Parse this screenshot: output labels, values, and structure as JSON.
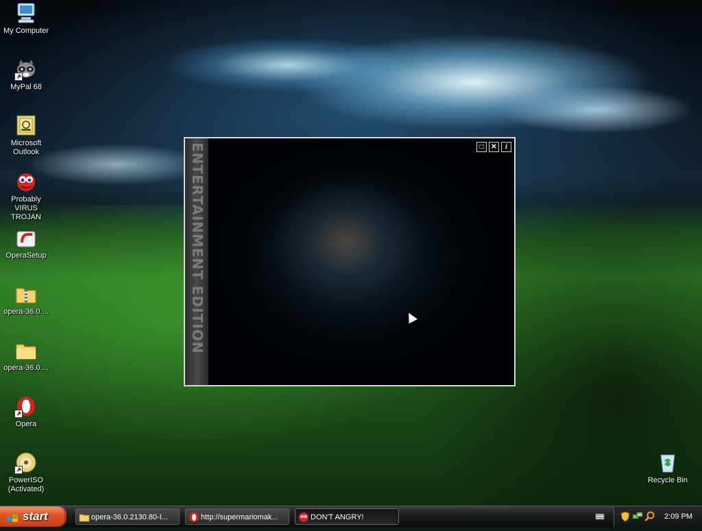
{
  "desktop": {
    "icons": [
      {
        "label": "My Computer",
        "icon": "my-computer-icon"
      },
      {
        "label": "MyPal 68",
        "icon": "raccoon-icon"
      },
      {
        "label": "Microsoft Outlook",
        "icon": "outlook-icon"
      },
      {
        "label": "Probably VIRUS TROJAN",
        "icon": "red-creature-icon"
      },
      {
        "label": "OperaSetup",
        "icon": "opera-setup-icon"
      },
      {
        "label": "opera-36.0....",
        "icon": "zip-folder-icon"
      },
      {
        "label": "opera-36.0....",
        "icon": "folder-icon"
      },
      {
        "label": "Opera",
        "icon": "opera-icon"
      },
      {
        "label": "PowerISO (Activated)",
        "icon": "poweriso-disc-icon"
      },
      {
        "label": "Recycle Bin",
        "icon": "recycle-bin-icon"
      }
    ]
  },
  "media_window": {
    "side_text": "ENTERTAINMENT EDITION",
    "buttons": {
      "restore": "□",
      "close": "✕",
      "info": "i"
    }
  },
  "taskbar": {
    "start_label": "start",
    "tasks": [
      {
        "label": "opera-36.0.2130.80-I...",
        "icon": "folder-icon"
      },
      {
        "label": "http://supermariomak...",
        "icon": "opera-icon"
      },
      {
        "label": "DON'T ANGRY!",
        "icon": "red-creature-icon",
        "active": true
      }
    ],
    "clock": "2:09 PM"
  },
  "colors": {
    "taskbar": "#1c1c1c",
    "start_button": "#e0552a",
    "window_border": "#d8d8d8"
  }
}
